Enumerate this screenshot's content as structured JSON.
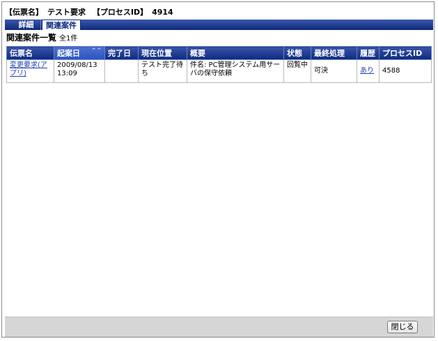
{
  "header": {
    "form_label": "【伝票名】",
    "form_value": "テスト要求",
    "process_label": "【プロセスID】",
    "process_value": "4914"
  },
  "tabs": [
    {
      "label": "詳細",
      "active": false
    },
    {
      "label": "関連案件",
      "active": true
    }
  ],
  "list": {
    "title": "関連案件一覧",
    "count": "全1件"
  },
  "table": {
    "headers": [
      "伝票名",
      "起案日",
      "完了日",
      "現在位置",
      "概要",
      "状態",
      "最終処理",
      "履歴",
      "プロセスID"
    ],
    "sort_icon": "double-chevron-up",
    "rows": [
      {
        "form": "変更要求(アプリ)",
        "draft_date": "2009/08/13 13:09",
        "complete_date": "",
        "position": "テスト完了待ち",
        "summary": "件名: PC管理システム用サーバの保守依頼",
        "status": "回覧中",
        "last_action": "可決",
        "history": "あり",
        "process_id": "4588"
      }
    ]
  },
  "footer": {
    "close_label": "閉じる"
  }
}
